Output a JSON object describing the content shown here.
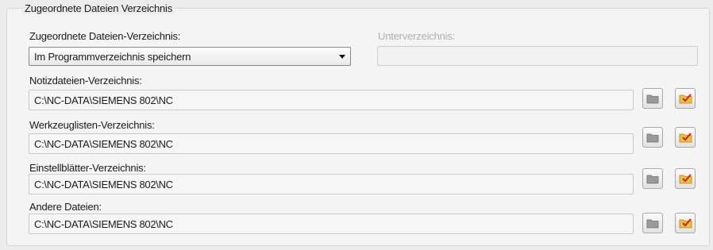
{
  "group": {
    "title": "Zugeordnete Dateien Verzeichnis"
  },
  "assigned_dir": {
    "label": "Zugeordnete Dateien-Verzeichnis:",
    "selected": "Im Programmverzeichnis speichern"
  },
  "subdir": {
    "label": "Unterverzeichnis:",
    "value": ""
  },
  "rows": [
    {
      "label": "Notizdateien-Verzeichnis:",
      "path": "C:\\NC-DATA\\SIEMENS 802\\NC"
    },
    {
      "label": "Werkzeuglisten-Verzeichnis:",
      "path": "C:\\NC-DATA\\SIEMENS 802\\NC"
    },
    {
      "label": "Einstellblätter-Verzeichnis:",
      "path": "C:\\NC-DATA\\SIEMENS 802\\NC"
    },
    {
      "label": "Andere Dateien:",
      "path": "C:\\NC-DATA\\SIEMENS 802\\NC"
    }
  ],
  "icons": {
    "browse": "folder-icon",
    "confirm": "checkmark-folder-icon"
  },
  "colors": {
    "folder_gray": "#9a9a9a",
    "folder_yellow": "#f0c040",
    "check_red": "#d02020"
  }
}
